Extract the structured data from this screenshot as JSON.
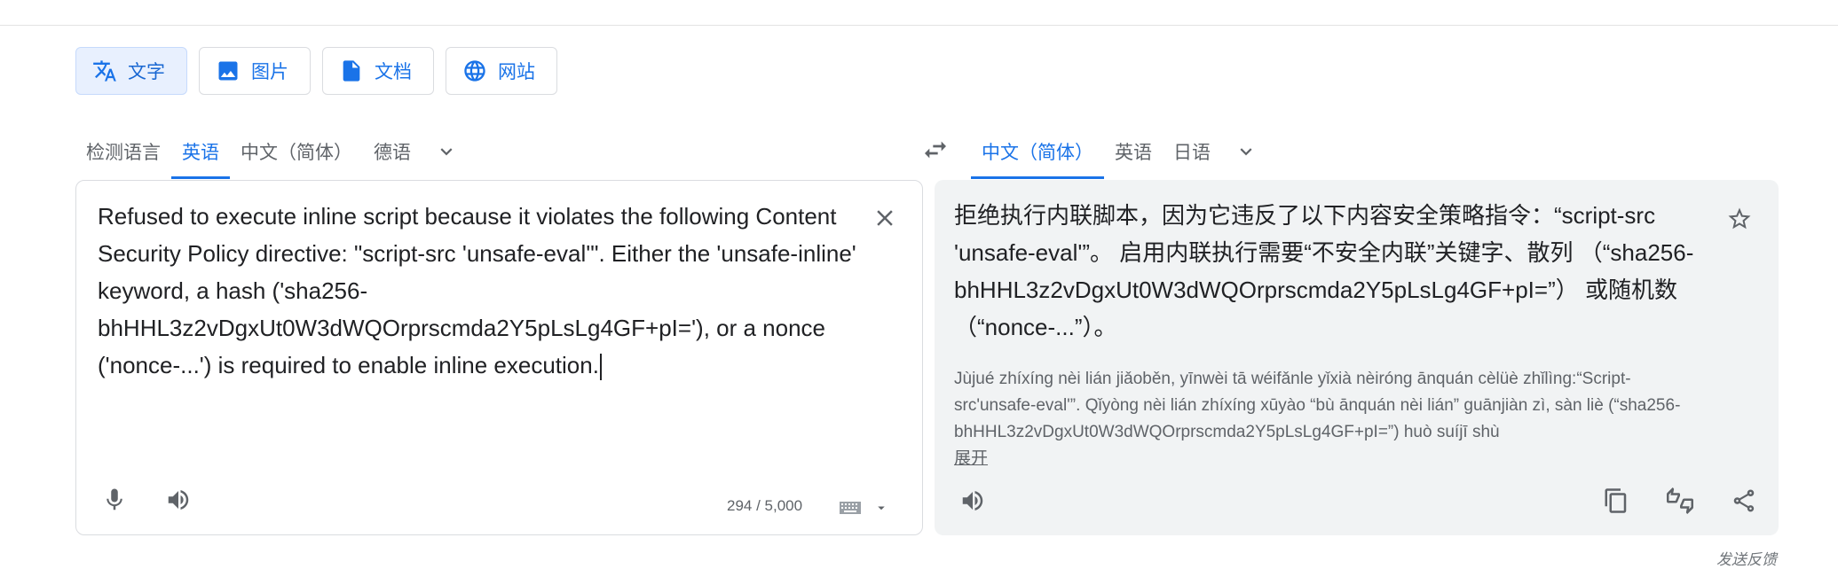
{
  "modes": [
    {
      "label": "文字",
      "icon": "translate-icon",
      "active": true
    },
    {
      "label": "图片",
      "icon": "image-icon"
    },
    {
      "label": "文档",
      "icon": "document-icon"
    },
    {
      "label": "网站",
      "icon": "globe-icon"
    }
  ],
  "source_langs": {
    "detect": "检测语言",
    "english": "英语",
    "chinese_simplified": "中文（简体）",
    "german": "德语"
  },
  "target_langs": {
    "chinese_simplified": "中文（简体）",
    "english": "英语",
    "japanese": "日语"
  },
  "source": {
    "text": "Refused to execute inline script because it violates the following Content Security Policy directive: \"script-src 'unsafe-eval'\". Either the 'unsafe-inline' keyword, a hash ('sha256-bhHHL3z2vDgxUt0W3dWQOrprscmda2Y5pLsLg4GF+pI='), or a nonce ('nonce-...') is required to enable inline execution.",
    "char_count": "294 / 5,000"
  },
  "target": {
    "text": "拒绝执行内联脚本，因为它违反了以下内容安全策略指令：“script-src 'unsafe-eval'”。 启用内联执行需要“不安全内联”关键字、散列 （“sha256-bhHHL3z2vDgxUt0W3dWQOrprscmda2Y5pLsLg4GF+pI=”） 或随机数（“nonce-...”）。",
    "transliteration": "Jùjué zhíxíng nèi lián jiǎoběn, yīnwèi tā wéifǎnle yǐxià nèiróng ānquán cèlüè zhǐlìng:“Script-src'unsafe-eval'”. Qǐyòng nèi lián zhíxíng xūyào “bù ānquán nèi lián” guānjiàn zì, sàn liè (“sha256-bhHHL3z2vDgxUt0W3dWQOrprscmda2Y5pLsLg4GF+pI=”) huò suíjī shù",
    "expand": "展开"
  },
  "feedback": "发送反馈",
  "colors": {
    "accent": "#1a73e8",
    "panel_bg": "#f1f3f4",
    "border": "#dadce0"
  }
}
